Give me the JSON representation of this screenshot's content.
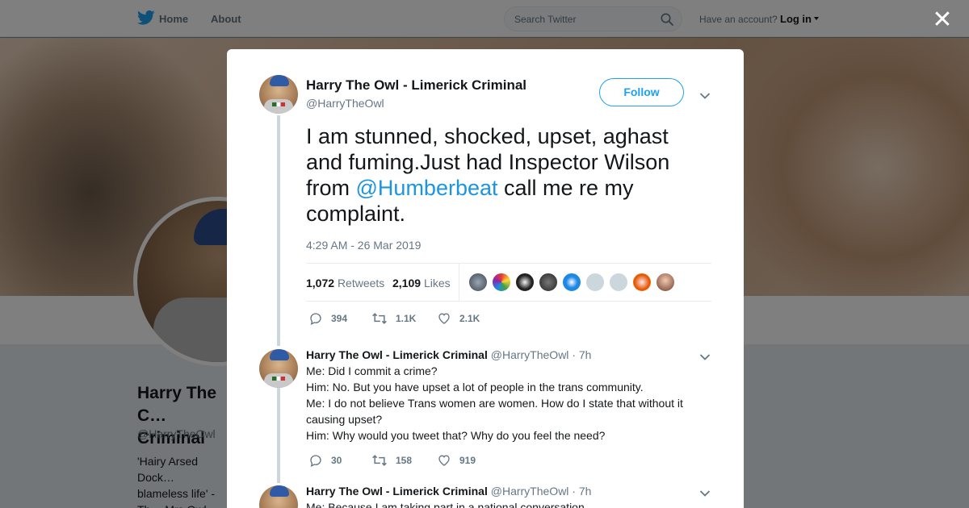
{
  "nav": {
    "home_label": "Home",
    "about_label": "About",
    "search_placeholder": "Search Twitter",
    "account_prompt": "Have an account?",
    "login_label": "Log in"
  },
  "profile": {
    "name": "Harry The Owl - Limerick Criminal",
    "name_visible": "Harry The C… Criminal",
    "handle": "@HarryTheOwl",
    "bio": "'Hairy Arsed Dock… blameless life' - Th… Mrs Owl."
  },
  "tweet": {
    "author_name": "Harry The Owl - Limerick Criminal",
    "author_handle": "@HarryTheOwl",
    "follow_label": "Follow",
    "text_before": "I am stunned, shocked, upset, aghast and fuming.Just had Inspector Wilson from ",
    "mention": "@Humberbeat",
    "text_after": " call me re my complaint.",
    "timestamp": "4:29 AM - 26 Mar 2019",
    "retweets_count": "1,072",
    "retweets_label": "Retweets",
    "likes_count": "2,109",
    "likes_label": "Likes",
    "replies": "394",
    "retweets_short": "1.1K",
    "likes_short": "2.1K"
  },
  "replies": [
    {
      "author_name": "Harry The Owl - Limerick Criminal",
      "author_handle": "@HarryTheOwl",
      "age": "· 7h",
      "lines": [
        "Me: Did I commit a crime?",
        "Him: No. But you have upset a lot of people in the trans community.",
        "Me: I do not believe Trans women are women. How do I state that without it causing upset?",
        "Him: Why would you tweet that? Why do you feel the need?"
      ],
      "replies": "30",
      "retweets": "158",
      "likes": "919"
    },
    {
      "author_name": "Harry The Owl - Limerick Criminal",
      "author_handle": "@HarryTheOwl",
      "age": "· 7h",
      "lines": [
        "Me: Because I am taking part in a national conversation."
      ]
    }
  ],
  "colors": {
    "accent": "#1da1f2",
    "mention": "#1b95e0",
    "muted": "#657786"
  }
}
